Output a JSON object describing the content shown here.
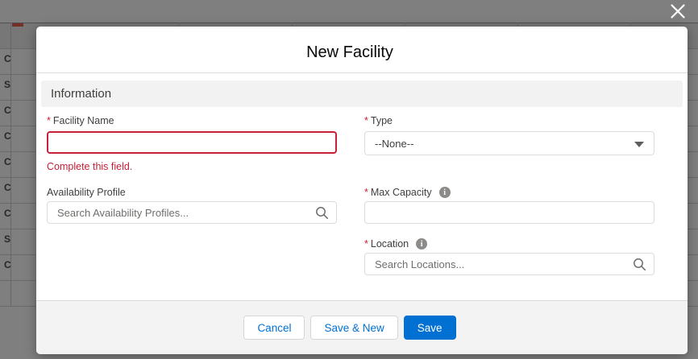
{
  "required_marker": "*",
  "modal": {
    "title": "New Facility",
    "section_title": "Information",
    "form": {
      "facility_name": {
        "label": "Facility Name",
        "required": true,
        "value": "",
        "error": "Complete this field."
      },
      "type": {
        "label": "Type",
        "required": true,
        "selected": "--None--"
      },
      "availability_profile": {
        "label": "Availability Profile",
        "required": false,
        "value": "",
        "placeholder": "Search Availability Profiles..."
      },
      "max_capacity": {
        "label": "Max Capacity",
        "required": true,
        "value": ""
      },
      "location": {
        "label": "Location",
        "required": true,
        "value": "",
        "placeholder": "Search Locations..."
      }
    },
    "footer": {
      "cancel_label": "Cancel",
      "save_new_label": "Save & New",
      "save_label": "Save"
    }
  },
  "icons": {
    "info_glyph": "i"
  },
  "colors": {
    "brand_blue": "#0070d2",
    "error_red": "#c62139",
    "label_gray": "#3e3e3c",
    "placeholder_gray": "#706e6b",
    "section_bar_bg": "#f3f2f2",
    "footer_bg": "#f4f3f3"
  },
  "background": {
    "row_marks": [
      "C",
      "S",
      "C",
      "C",
      "C",
      "C",
      "C",
      "S",
      "C"
    ]
  }
}
